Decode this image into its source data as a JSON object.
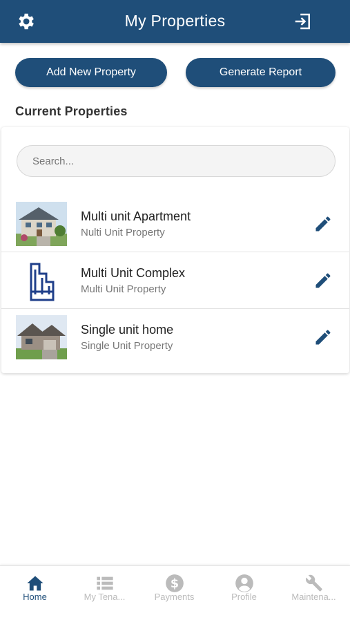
{
  "header": {
    "title": "My Properties",
    "left_icon": "gear-icon",
    "right_icon": "logout-icon"
  },
  "actions": {
    "add_label": "Add New Property",
    "report_label": "Generate Report"
  },
  "section_title": "Current Properties",
  "search": {
    "placeholder": "Search..."
  },
  "properties": [
    {
      "name": "Multi unit Apartment",
      "type": "Nulti Unit Property",
      "thumb": "house-photo"
    },
    {
      "name": "Multi Unit Complex",
      "type": "Multi Unit Property",
      "thumb": "building-icon"
    },
    {
      "name": "Single unit home",
      "type": "Single Unit Property",
      "thumb": "house-photo"
    }
  ],
  "tabs": [
    {
      "label": "Home",
      "icon": "home-icon",
      "active": true
    },
    {
      "label": "My Tena...",
      "icon": "list-icon",
      "active": false
    },
    {
      "label": "Payments",
      "icon": "dollar-icon",
      "active": false
    },
    {
      "label": "Profile",
      "icon": "user-icon",
      "active": false
    },
    {
      "label": "Maintena...",
      "icon": "wrench-icon",
      "active": false
    }
  ],
  "colors": {
    "primary": "#1f4e79",
    "inactive": "#bbbbbb"
  }
}
